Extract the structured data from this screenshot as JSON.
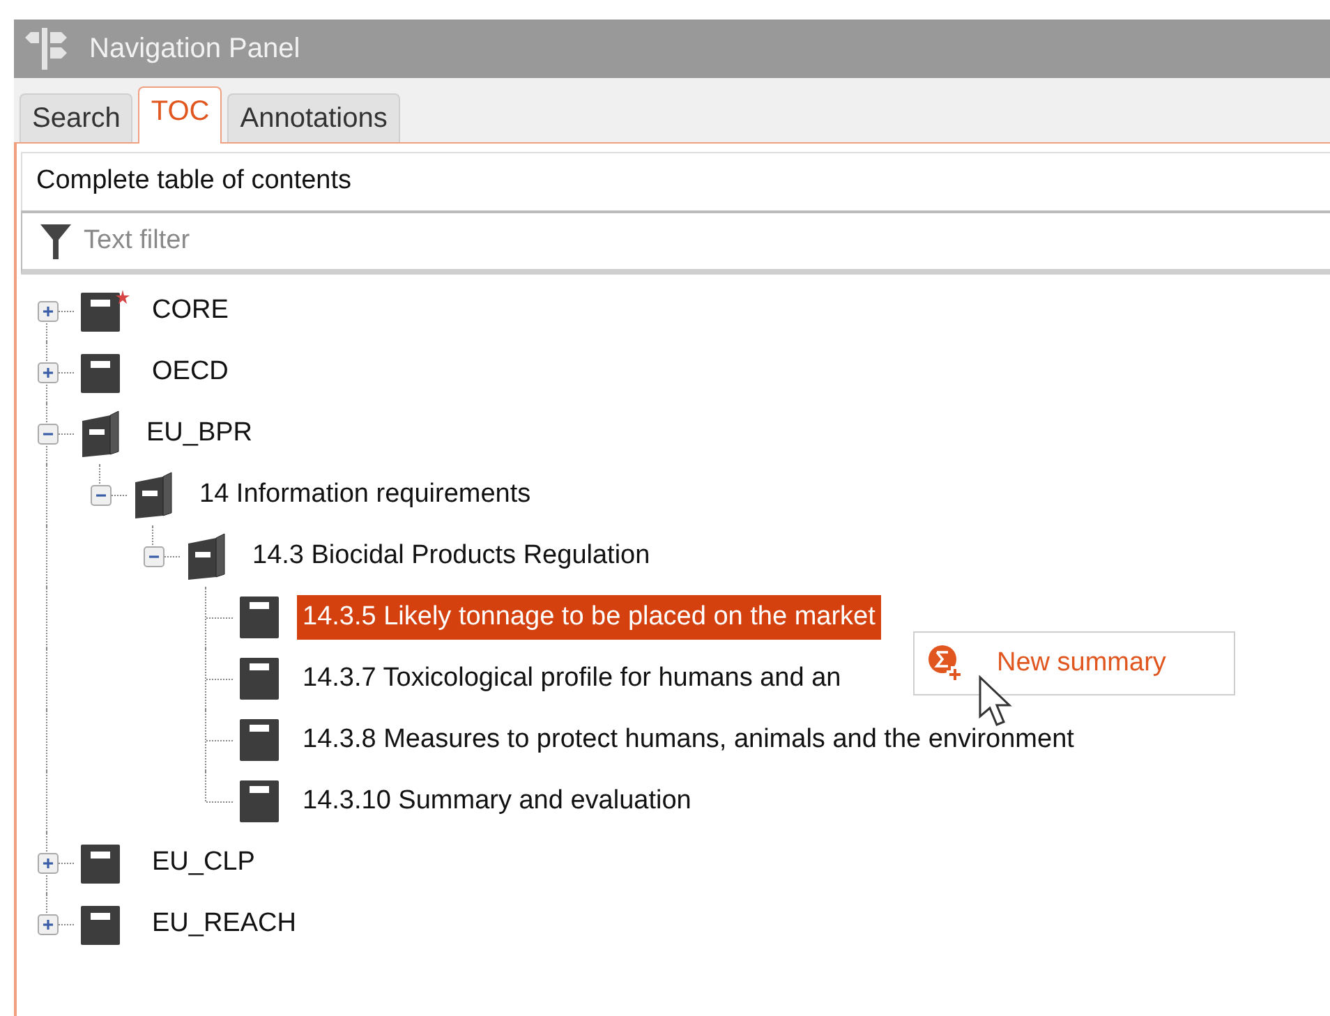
{
  "window": {
    "title": "Navigation Panel"
  },
  "tabs": [
    {
      "label": "Search",
      "selected": false
    },
    {
      "label": "TOC",
      "selected": true
    },
    {
      "label": "Annotations",
      "selected": false
    }
  ],
  "panel": {
    "header": "Complete table of contents",
    "filter": {
      "placeholder": "Text filter"
    }
  },
  "tree": [
    {
      "label": "CORE",
      "kind": "branch",
      "expanded": false,
      "modified": true,
      "selected": false
    },
    {
      "label": "OECD",
      "kind": "branch",
      "expanded": false,
      "modified": false,
      "selected": false
    },
    {
      "label": "EU_BPR",
      "kind": "branch",
      "expanded": true,
      "modified": false,
      "selected": false,
      "children": [
        {
          "label": "14 Information requirements",
          "kind": "branch",
          "expanded": true,
          "modified": false,
          "selected": false,
          "children": [
            {
              "label": "14.3 Biocidal Products Regulation",
              "kind": "branch",
              "expanded": true,
              "modified": false,
              "selected": false,
              "children": [
                {
                  "label": "14.3.5 Likely tonnage to be placed on the market",
                  "kind": "leaf",
                  "modified": false,
                  "selected": true
                },
                {
                  "label": "14.3.7 Toxicological profile for humans and an",
                  "kind": "leaf",
                  "modified": false,
                  "selected": false
                },
                {
                  "label": "14.3.8 Measures to protect humans, animals and the environment",
                  "kind": "leaf",
                  "modified": false,
                  "selected": false
                },
                {
                  "label": "14.3.10 Summary and evaluation",
                  "kind": "leaf",
                  "modified": false,
                  "selected": false
                }
              ]
            }
          ]
        }
      ]
    },
    {
      "label": "EU_CLP",
      "kind": "branch",
      "expanded": false,
      "modified": false,
      "selected": false
    },
    {
      "label": "EU_REACH",
      "kind": "branch",
      "expanded": false,
      "modified": false,
      "selected": false
    }
  ],
  "context_menu": {
    "items": [
      {
        "label": "New summary"
      }
    ]
  }
}
